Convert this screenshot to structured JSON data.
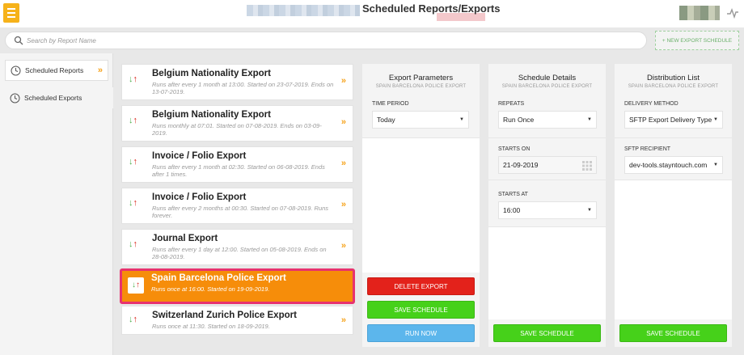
{
  "header": {
    "title": "Scheduled Reports/Exports"
  },
  "search": {
    "placeholder": "Search by Report Name"
  },
  "toolbar": {
    "new_export_label": "+ NEW EXPORT SCHEDULE"
  },
  "sidebar": {
    "items": [
      {
        "label": "Scheduled Reports",
        "icon": "clock-icon"
      },
      {
        "label": "Scheduled Exports",
        "icon": "clock-icon"
      }
    ]
  },
  "reports": [
    {
      "name": "Belgium Nationality Export",
      "desc": "Runs after every 1 month at 13:00. Started on 23-07-2019. Ends on 13-07-2019."
    },
    {
      "name": "Belgium Nationality Export",
      "desc": "Runs monthly at 07:01. Started on 07-08-2019. Ends on 03-09-2019."
    },
    {
      "name": "Invoice / Folio Export",
      "desc": "Runs after every 1 month at 02:30. Started on 06-08-2019. Ends after 1 times."
    },
    {
      "name": "Invoice / Folio Export",
      "desc": "Runs after every 2 months at 00:30. Started on 07-08-2019. Runs forever."
    },
    {
      "name": "Journal Export",
      "desc": "Runs after every 1 day at 12:00. Started on 05-08-2019. Ends on 28-08-2019."
    },
    {
      "name": "Spain Barcelona Police Export",
      "desc": "Runs once at 16:00. Started on 19-09-2019."
    },
    {
      "name": "Switzerland Zurich Police Export",
      "desc": "Runs once at 11:30. Started on 18-09-2019."
    }
  ],
  "export_params": {
    "title": "Export Parameters",
    "subtitle": "SPAIN BARCELONA POLICE EXPORT",
    "time_period_label": "TIME PERIOD",
    "time_period_value": "Today",
    "delete_label": "DELETE EXPORT",
    "save_label": "SAVE SCHEDULE",
    "run_label": "RUN NOW"
  },
  "schedule": {
    "title": "Schedule Details",
    "subtitle": "SPAIN BARCELONA POLICE EXPORT",
    "repeats_label": "REPEATS",
    "repeats_value": "Run Once",
    "starts_on_label": "STARTS ON",
    "starts_on_value": "21-09-2019",
    "starts_at_label": "STARTS AT",
    "starts_at_value": "16:00",
    "save_label": "SAVE SCHEDULE"
  },
  "distribution": {
    "title": "Distribution List",
    "subtitle": "SPAIN BARCELONA POLICE EXPORT",
    "delivery_label": "DELIVERY METHOD",
    "delivery_value": "SFTP Export Delivery Type",
    "recipient_label": "SFTP RECIPIENT",
    "recipient_value": "dev-tools.stayntouch.com",
    "save_label": "SAVE SCHEDULE"
  },
  "colors": {
    "accent": "#f6a21a",
    "selected_bg": "#f68d0a",
    "selected_border": "#e8326e",
    "delete": "#e3221b",
    "save": "#46d11a",
    "run": "#5cb6ec"
  }
}
